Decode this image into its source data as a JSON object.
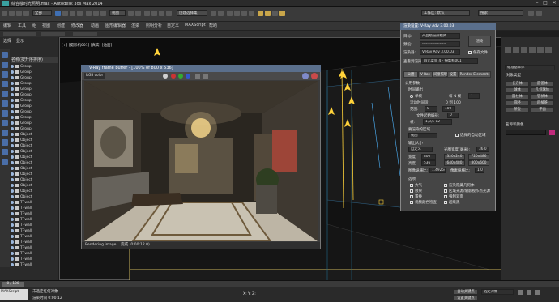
{
  "window": {
    "title": "综合楼时光照明.max - Autodesk 3ds Max 2014"
  },
  "toolbar": {
    "selection_filter": "全部",
    "view_dropdown": "视图",
    "snap_dropdown": "创建选择集",
    "workspace_dropdown": "工作区: 默认"
  },
  "menu": {
    "items": [
      "编辑",
      "工具",
      "组",
      "视图",
      "创建",
      "修改器",
      "动画",
      "图形编辑器",
      "渲染",
      "照明分析",
      "自定义",
      "MAXScript",
      "帮助"
    ],
    "search_placeholder": "搜索"
  },
  "explorer": {
    "tabs": [
      "选择",
      "显示"
    ],
    "header": "名称(按升序排序)",
    "rows": [
      "Group",
      "Group",
      "Group",
      "Group",
      "Group",
      "Group",
      "Group",
      "Group",
      "Group",
      "Group",
      "Group",
      "Group",
      "Object",
      "Object",
      "Object",
      "Object",
      "Object",
      "Object",
      "Object",
      "Object",
      "Object",
      "Object",
      "Object",
      "Object",
      "TFwall",
      "TFwall",
      "TFwall",
      "TFwall",
      "TFwall",
      "TFwall",
      "TFwall",
      "TFwall",
      "TFwall",
      "TFwall",
      "TFwall",
      "TFwall"
    ]
  },
  "viewport": {
    "label": "[+] [摄影机001] [真实] [边面]"
  },
  "frame_buffer": {
    "title": "V-Ray frame buffer - [100% of 800 x 536]",
    "channel": "RGB color",
    "status": "Rendering image... 完成 (0:00:12.0)"
  },
  "render_setup": {
    "title": "渲染设置: V-Ray Adv 3.00.03",
    "target_label": "目标:",
    "target_value": "产品级渲染模式",
    "preset_label": "预设:",
    "preset_value": "-------------------",
    "renderer_label": "渲染器:",
    "renderer_value": "V-Ray Adv 3.00.03",
    "render_button": "渲染",
    "save_file": "保存文件",
    "view_label": "查看到渲染:",
    "view_value": "四元菜单 4 - 摄影机001",
    "tabs": [
      "公用",
      "V-Ray",
      "间接照明",
      "设置",
      "Render Elements"
    ],
    "rollout": "公用参数",
    "time_output": "时间输出",
    "single": "单帧",
    "every_n": "每 N 帧",
    "every_n_value": "1",
    "active_segment": "活动时间段:",
    "active_range": "0 到 100",
    "range": "范围:",
    "range_start": "0",
    "range_end": "100",
    "file_numbering": "文件起始编号:",
    "file_num_value": "0",
    "frames": "帧:",
    "frames_value": "1,3,5-12",
    "render_area": "要渲染的区域",
    "render_area_value": "视图",
    "auto_region": "选择的自动区域",
    "output_size": "输出大小",
    "custom": "自定义",
    "aperture": "光圈宽度(毫米):",
    "aperture_value": "36.0",
    "width": "宽度:",
    "width_value": "800",
    "height": "高度:",
    "height_value": "536",
    "presets": [
      "320x240",
      "720x486",
      "640x480",
      "800x600"
    ],
    "aspect": "图像纵横比:",
    "aspect_value": "1.49254",
    "pixel_aspect": "像素纵横比:",
    "pixel_value": "1.0",
    "options": "选项",
    "opts": [
      "大气",
      "效果",
      "置换",
      "视频颜色检查",
      "渲染隐藏几何体",
      "区域光源/阴影视作点光源",
      "强制双面",
      "超级黑"
    ]
  },
  "command_panel": {
    "section": "对象类型",
    "buttons": [
      "长方体",
      "圆锥体",
      "球体",
      "几何球体",
      "圆柱体",
      "管状体",
      "圆环",
      "四棱锥",
      "茶壶",
      "平面"
    ],
    "name_section": "名称和颜色",
    "dropdown": "标准基本体"
  },
  "status": {
    "frame": "0 / 100",
    "msg1": "未选定任何对象",
    "msg2": "渲染时间 0:00:12",
    "coords": "X: Y: Z:",
    "auto_key": "自动关键点",
    "set_key": "设置关键点",
    "selected": "选定对象"
  }
}
